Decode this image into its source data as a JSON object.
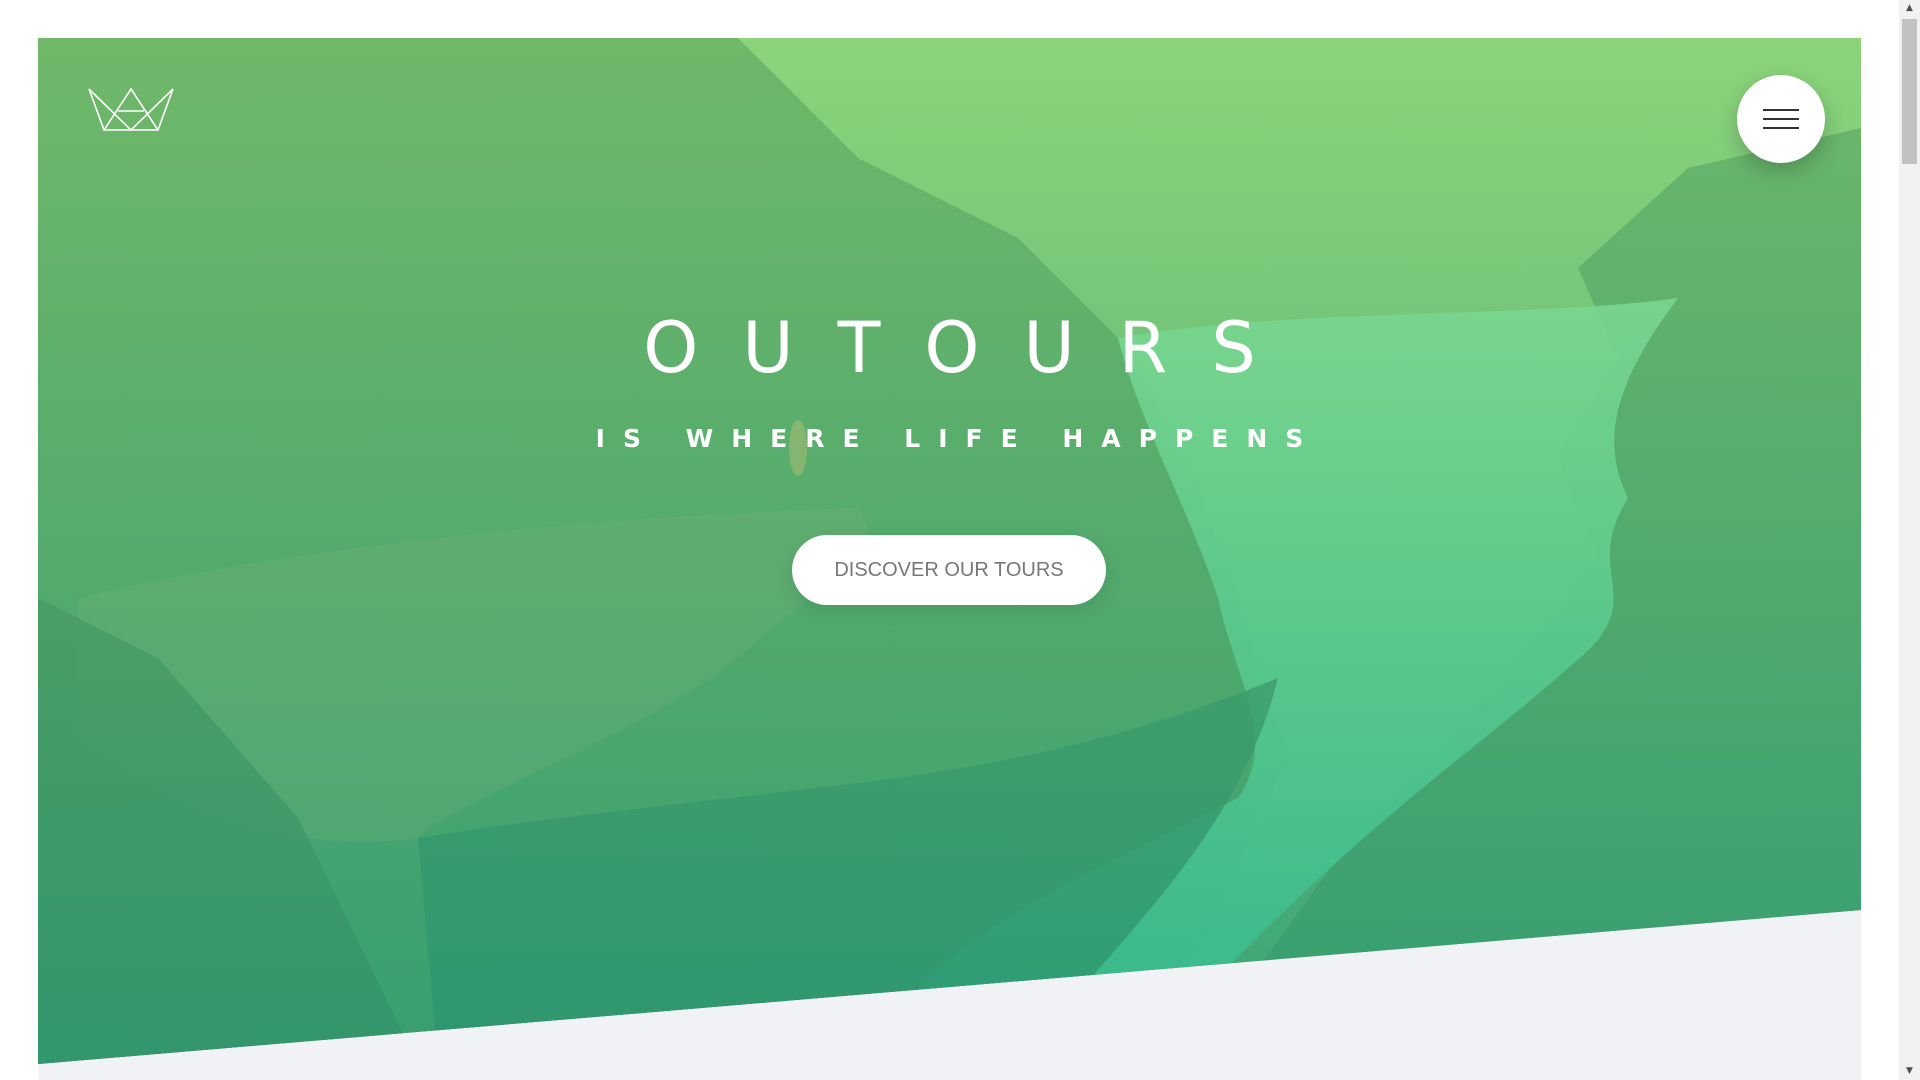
{
  "header": {
    "logo_icon": "crown-logo-icon",
    "menu_icon": "hamburger-menu-icon"
  },
  "hero": {
    "title": "OUTOURS",
    "subtitle": "IS WHERE LIFE HAPPENS",
    "cta_label": "DISCOVER OUR TOURS",
    "overlay_colors": [
      "#7ed56f",
      "#28b485"
    ]
  },
  "scrollbar": {
    "up_arrow": "▲",
    "down_arrow": "▼"
  },
  "colors": {
    "page_background": "#f1f2f6",
    "button_background": "#ffffff",
    "button_text": "#777777",
    "hero_text": "#ffffff"
  }
}
